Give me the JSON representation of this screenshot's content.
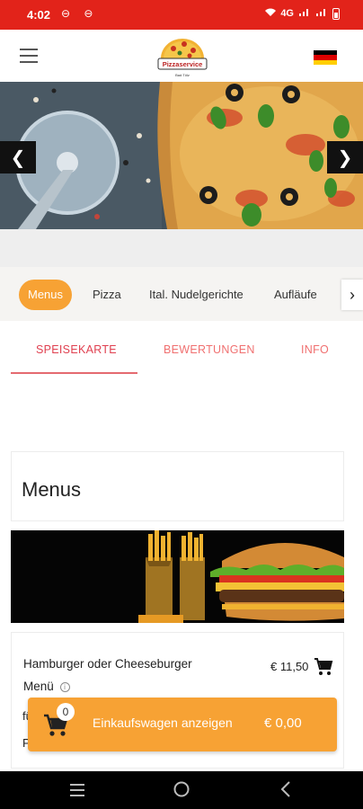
{
  "status_bar": {
    "time": "4:02",
    "notifications": "⊖ ⊖",
    "signal_text": "4G",
    "battery_icon": "battery-icon"
  },
  "header": {
    "menu_icon": "hamburger-menu-icon",
    "logo_text": "Pizzaservice",
    "logo_subtext": "Bad Tölz",
    "language_flag": "german-flag-icon"
  },
  "hero": {
    "prev_label": "❮",
    "next_label": "❯"
  },
  "categories": {
    "items": [
      "Menus",
      "Pizza",
      "Ital. Nudelgerichte",
      "Aufläufe"
    ],
    "active": "Menus",
    "next_label": "›"
  },
  "tabs": {
    "items": [
      "SPEISEKARTE",
      "BEWERTUNGEN",
      "INFO"
    ],
    "active": "SPEISEKARTE"
  },
  "section": {
    "title": "Menus"
  },
  "item": {
    "name_line1": "Hamburger oder Cheeseburger",
    "name_line2": "Menü",
    "price": "€ 11,50",
    "extra_line1": "fü",
    "extra_line2": "P"
  },
  "cart": {
    "count": "0",
    "label": "Einkaufswagen anzeigen",
    "total": "€ 0,00"
  },
  "colors": {
    "status_red": "#e2231a",
    "accent_orange": "#f7a234",
    "tab_pink": "#e46a70"
  }
}
